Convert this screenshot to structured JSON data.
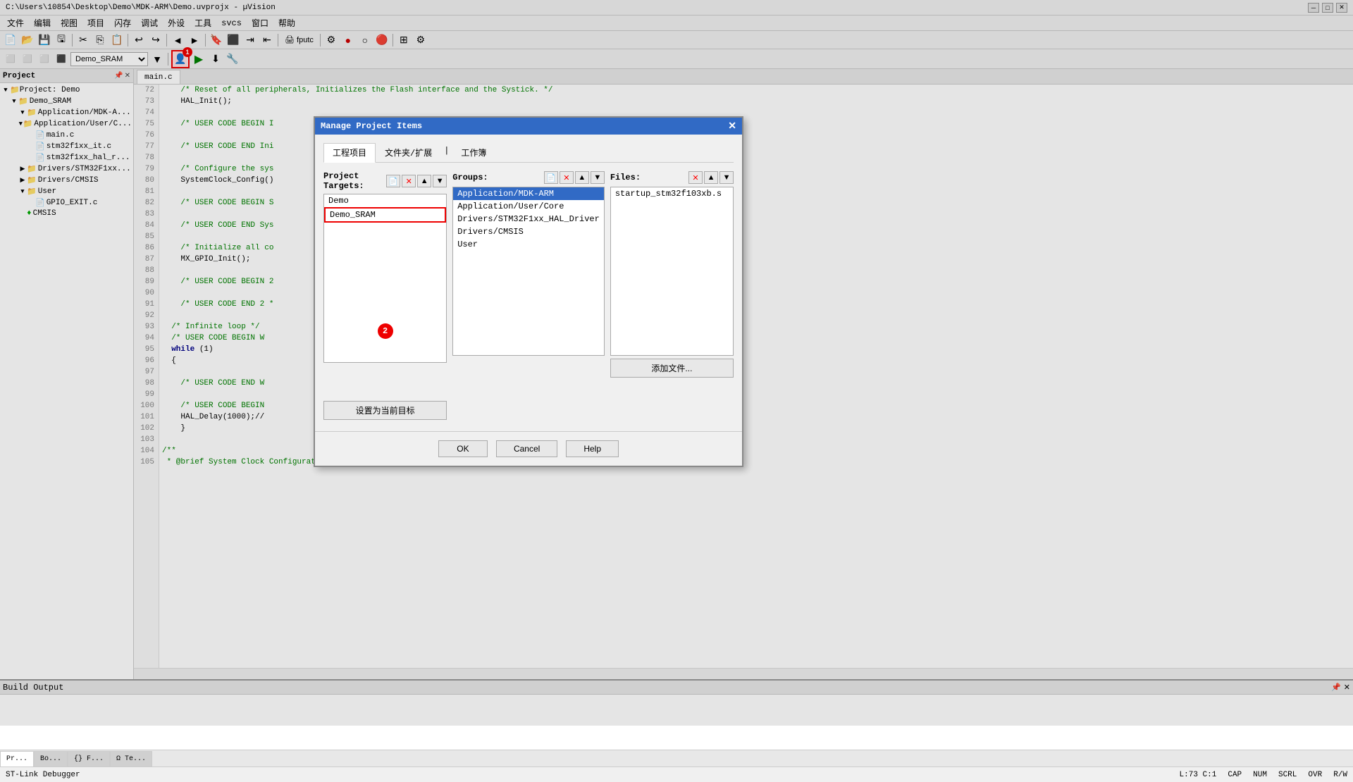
{
  "titlebar": {
    "text": "C:\\Users\\10854\\Desktop\\Demo\\MDK-ARM\\Demo.uvprojx - µVision",
    "min": "─",
    "max": "□",
    "close": "✕"
  },
  "menubar": {
    "items": [
      "文件",
      "编辑",
      "视图",
      "项目",
      "闪存",
      "调试",
      "外设",
      "工具",
      "svcs",
      "窗口",
      "帮助"
    ]
  },
  "toolbar1": {
    "dropdown_value": "Demo_SRAM"
  },
  "editor": {
    "tab": "main.c",
    "lines": [
      {
        "num": "72",
        "code": "    /* Reset of all peripherals, Initializes the Flash interface and the Systick. */"
      },
      {
        "num": "73",
        "code": "    HAL_Init();"
      },
      {
        "num": "74",
        "code": ""
      },
      {
        "num": "75",
        "code": "    /* USER CODE BEGIN I"
      },
      {
        "num": "76",
        "code": ""
      },
      {
        "num": "77",
        "code": "    /* USER CODE END Ini"
      },
      {
        "num": "78",
        "code": ""
      },
      {
        "num": "79",
        "code": "    /* Configure the sys"
      },
      {
        "num": "80",
        "code": "    SystemClock_Config()"
      },
      {
        "num": "81",
        "code": ""
      },
      {
        "num": "82",
        "code": "    /* USER CODE BEGIN S"
      },
      {
        "num": "83",
        "code": ""
      },
      {
        "num": "84",
        "code": "    /* USER CODE END Sys"
      },
      {
        "num": "85",
        "code": ""
      },
      {
        "num": "86",
        "code": "    /* Initialize all co"
      },
      {
        "num": "87",
        "code": "    MX_GPIO_Init();"
      },
      {
        "num": "88",
        "code": ""
      },
      {
        "num": "89",
        "code": "    /* USER CODE BEGIN 2"
      },
      {
        "num": "90",
        "code": ""
      },
      {
        "num": "91",
        "code": "    /* USER CODE END 2 *"
      },
      {
        "num": "92",
        "code": ""
      },
      {
        "num": "93",
        "code": "  /* Infinite loop */"
      },
      {
        "num": "94",
        "code": "  /* USER CODE BEGIN W"
      },
      {
        "num": "95",
        "code": "  while (1)"
      },
      {
        "num": "96",
        "code": "  {"
      },
      {
        "num": "97",
        "code": ""
      },
      {
        "num": "98",
        "code": "    /* USER CODE END W"
      },
      {
        "num": "99",
        "code": ""
      },
      {
        "num": "100",
        "code": "    /* USER CODE BEGIN"
      },
      {
        "num": "101",
        "code": "    HAL_Delay(1000);//"
      },
      {
        "num": "102",
        "code": "    }"
      },
      {
        "num": "103",
        "code": ""
      },
      {
        "num": "104",
        "code": "/**"
      },
      {
        "num": "105",
        "code": " * @brief System Clock Configuration"
      }
    ]
  },
  "project": {
    "title": "Project",
    "root": "Project: Demo",
    "tree": [
      {
        "label": "Demo_SRAM",
        "type": "folder",
        "indent": 1,
        "expanded": true
      },
      {
        "label": "Application/MDK-A...",
        "type": "folder",
        "indent": 2,
        "expanded": true
      },
      {
        "label": "Application/User/C...",
        "type": "folder",
        "indent": 2,
        "expanded": true
      },
      {
        "label": "main.c",
        "type": "file",
        "indent": 3
      },
      {
        "label": "stm32f1xx_it.c",
        "type": "file",
        "indent": 3
      },
      {
        "label": "stm32f1xx_hal_r...",
        "type": "file",
        "indent": 3
      },
      {
        "label": "Drivers/STM32F1xx...",
        "type": "folder",
        "indent": 2,
        "expanded": false
      },
      {
        "label": "Drivers/CMSIS",
        "type": "folder",
        "indent": 2,
        "expanded": false
      },
      {
        "label": "User",
        "type": "folder",
        "indent": 2,
        "expanded": true
      },
      {
        "label": "GPIO_EXIT.c",
        "type": "file",
        "indent": 3
      },
      {
        "label": "CMSIS",
        "type": "diamond",
        "indent": 2
      }
    ]
  },
  "dialog": {
    "title": "Manage Project Items",
    "tabs": [
      "工程项目",
      "文件夹/扩展",
      "工作簿"
    ],
    "active_tab": 0,
    "col1_label": "Project Targets:",
    "col2_label": "Groups:",
    "col3_label": "Files:",
    "col1_items": [
      "Demo",
      "Demo_SRAM"
    ],
    "col1_selected": 1,
    "col2_items": [
      "Application/MDK-ARM",
      "Application/User/Core",
      "Drivers/STM32F1xx_HAL_Driver",
      "Drivers/CMSIS",
      "User"
    ],
    "col2_selected": 0,
    "col3_items": [
      "startup_stm32f103xb.s"
    ],
    "col3_selected": -1,
    "btn_set_target": "设置为当前目标",
    "btn_add_file": "添加文件...",
    "btn_ok": "OK",
    "btn_cancel": "Cancel",
    "btn_help": "Help",
    "badge1": "1",
    "badge2": "2"
  },
  "bottom_panel": {
    "title": "Build Output"
  },
  "bottom_tabs": [
    {
      "label": "Pr...",
      "active": true
    },
    {
      "label": "Bo...",
      "active": false
    },
    {
      "label": "{} F...",
      "active": false
    },
    {
      "label": "Ω Te...",
      "active": false
    }
  ],
  "statusbar": {
    "debugger": "ST-Link Debugger",
    "line_col": "L:73 C:1",
    "cap": "CAP",
    "num": "NUM",
    "scrl": "SCRL",
    "ovr": "OVR",
    "rw": "R/W"
  }
}
